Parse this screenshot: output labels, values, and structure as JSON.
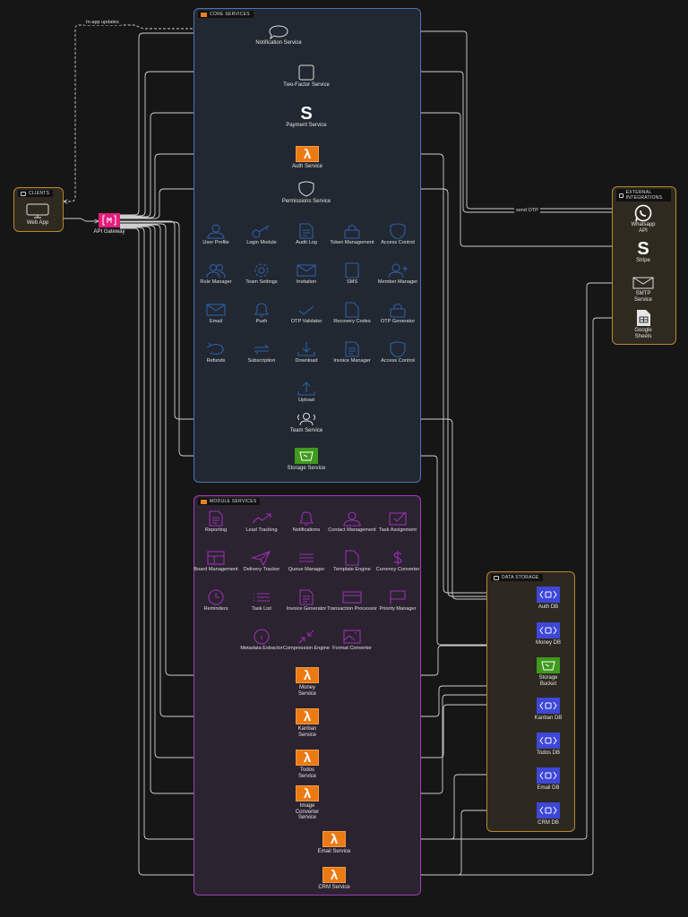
{
  "groups": {
    "clients": "Clients",
    "core": "Core Services",
    "module": "Module Services",
    "external": "External Integrations",
    "storage": "Data Storage"
  },
  "clients": {
    "web_app": "Web App"
  },
  "gateway": {
    "label": "API Gateway"
  },
  "edge_labels": {
    "in_app": "In-app updates",
    "send_otp": "send OTP"
  },
  "core_services": {
    "notification": "Notification Service",
    "two_factor": "Two-Factor Service",
    "payment": "Payment Service",
    "auth": "Auth Service",
    "permissions": "Permissions Service",
    "team": "Team Service",
    "storage": "Storage Service"
  },
  "core_grid": [
    {
      "label": "User Profile",
      "icon": "user-icon"
    },
    {
      "label": "Login Module",
      "icon": "key-icon"
    },
    {
      "label": "Audit Log",
      "icon": "document-icon"
    },
    {
      "label": "Token Management",
      "icon": "lock-icon"
    },
    {
      "label": "Access Control",
      "icon": "shield-icon"
    },
    {
      "label": "Role Manager",
      "icon": "users-icon"
    },
    {
      "label": "Team Settings",
      "icon": "gear-icon"
    },
    {
      "label": "Invitation",
      "icon": "mail-icon"
    },
    {
      "label": "SMS",
      "icon": "phone-icon"
    },
    {
      "label": "Member Manager",
      "icon": "user-plus-icon"
    },
    {
      "label": "Email",
      "icon": "mail-icon"
    },
    {
      "label": "Push",
      "icon": "bell-icon"
    },
    {
      "label": "OTP Validator",
      "icon": "check-icon"
    },
    {
      "label": "Recovery Codes",
      "icon": "file-icon"
    },
    {
      "label": "OTP Generator",
      "icon": "lock-icon"
    },
    {
      "label": "Refunds",
      "icon": "undo-icon"
    },
    {
      "label": "Subscription",
      "icon": "repeat-icon"
    },
    {
      "label": "Download",
      "icon": "download-icon"
    },
    {
      "label": "Invoice Manager",
      "icon": "document-icon"
    },
    {
      "label": "Access Control",
      "icon": "shield-icon"
    },
    {
      "label": "Upload",
      "icon": "upload-icon"
    }
  ],
  "module_grid": [
    {
      "label": "Reporting",
      "icon": "document-icon"
    },
    {
      "label": "Lead Tracking",
      "icon": "trend-icon"
    },
    {
      "label": "Notifications",
      "icon": "bell-icon"
    },
    {
      "label": "Contact Management",
      "icon": "user-icon"
    },
    {
      "label": "Task Assignment",
      "icon": "checkbox-icon"
    },
    {
      "label": "Board Management",
      "icon": "board-icon"
    },
    {
      "label": "Delivery Tracker",
      "icon": "send-icon"
    },
    {
      "label": "Queue Manager",
      "icon": "lines-icon"
    },
    {
      "label": "Template Engine",
      "icon": "file-icon"
    },
    {
      "label": "Currency Converter",
      "icon": "dollar-icon"
    },
    {
      "label": "Reminders",
      "icon": "clock-icon"
    },
    {
      "label": "Task List",
      "icon": "list-icon"
    },
    {
      "label": "Invoice Generator",
      "icon": "document-icon"
    },
    {
      "label": "Transaction Processor",
      "icon": "card-icon"
    },
    {
      "label": "Priority Manager",
      "icon": "flag-icon"
    },
    {
      "label": "Metadata Extractor",
      "icon": "info-icon"
    },
    {
      "label": "Compression Engine",
      "icon": "compress-icon"
    },
    {
      "label": "Format Converter",
      "icon": "image-icon"
    }
  ],
  "module_services": {
    "money": "Money Service",
    "kanban": "Kanban Service",
    "todos": "Todos Service",
    "image": "Image Converter Service",
    "email": "Email Service",
    "crm": "CRM Service"
  },
  "external": {
    "whatsapp": "Whatsapp API",
    "stripe": "Stripe",
    "smtp": "SMTP Service",
    "sheets": "Google Sheets"
  },
  "storage": {
    "auth_db": "Auth DB",
    "money_db": "Money DB",
    "bucket": "Storage Bucket",
    "kanban_db": "Kanban DB",
    "todos_db": "Todos DB",
    "email_db": "Email DB",
    "crm_db": "CRM DB"
  },
  "colors": {
    "core": "#4b74b5",
    "module": "#a23cb8",
    "external": "#b8862e",
    "lambda": "#ec7a13",
    "db": "#3e47d8",
    "gateway": "#e41c7c",
    "bucket": "#3e9a1d"
  }
}
